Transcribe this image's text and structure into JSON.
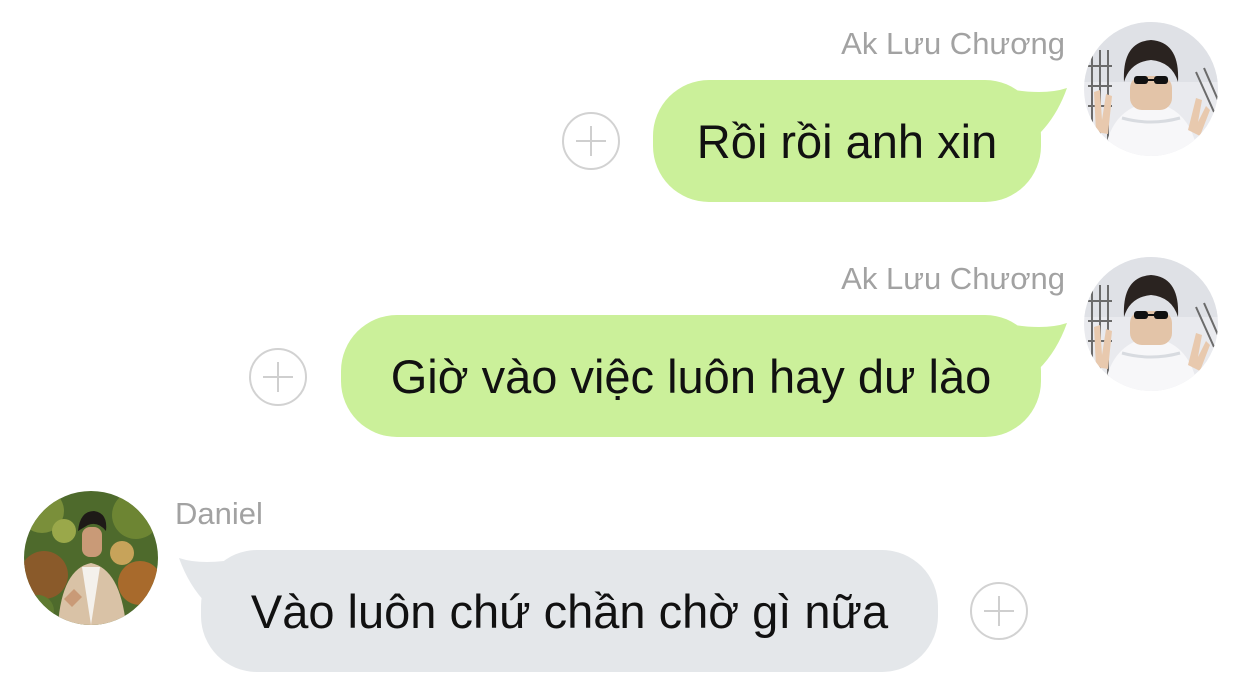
{
  "messages": [
    {
      "sender": "Ak Lưu Chương",
      "text": "Rồi rồi anh xin",
      "direction": "outgoing",
      "avatar_icon": "user-avatar-photo",
      "react_icon": "plus-circle-icon"
    },
    {
      "sender": "Ak Lưu Chương",
      "text": "Giờ vào việc luôn hay dư lào",
      "direction": "outgoing",
      "avatar_icon": "user-avatar-photo",
      "react_icon": "plus-circle-icon"
    },
    {
      "sender": "Daniel",
      "text": "Vào luôn chứ chần chờ gì nữa",
      "direction": "incoming",
      "avatar_icon": "user-avatar-photo",
      "react_icon": "plus-circle-icon"
    }
  ],
  "colors": {
    "outgoing_bubble": "#cbf09a",
    "incoming_bubble": "#e4e7ea",
    "sender_name": "#a2a2a2",
    "react_button": "#d2d2d2",
    "message_text": "#111111",
    "background": "#ffffff"
  }
}
